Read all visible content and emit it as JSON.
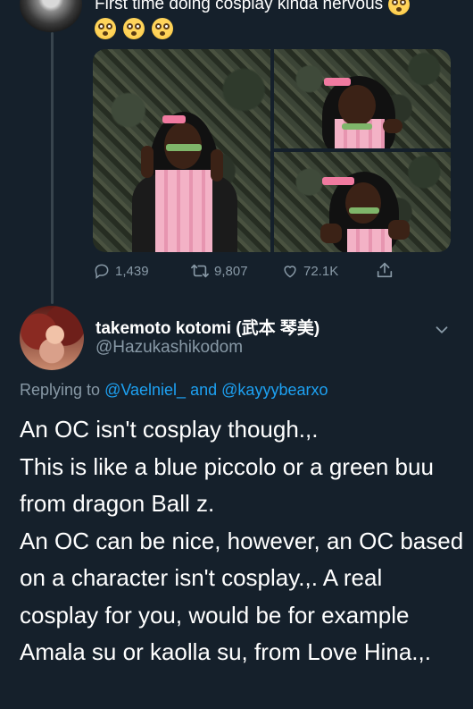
{
  "top_tweet": {
    "text": "First time doing cosplay kinda nervous",
    "emoji": [
      "flushed-face",
      "flushed-face",
      "flushed-face",
      "flushed-face"
    ]
  },
  "actions": {
    "replies": "1,439",
    "retweets": "9,807",
    "likes": "72.1K"
  },
  "reply": {
    "display_name": "takemoto kotomi (武本 琴美)",
    "handle": "@Hazukashikodom",
    "replying_prefix": "Replying to",
    "replying_to_1": "@Vaelniel_",
    "replying_and": "and",
    "replying_to_2": "@kayyybearxo",
    "lines": [
      "An OC isn't cosplay though.,.",
      "This is like a blue piccolo or a green buu from dragon Ball z.",
      "An OC can be nice, however, an OC based on a character isn't cosplay.,. A real cosplay for you, would be for example Amala su or kaolla su, from Love Hina.,."
    ]
  },
  "colors": {
    "background": "#15202b",
    "secondary_text": "#8899a6",
    "link": "#1da1f2"
  }
}
